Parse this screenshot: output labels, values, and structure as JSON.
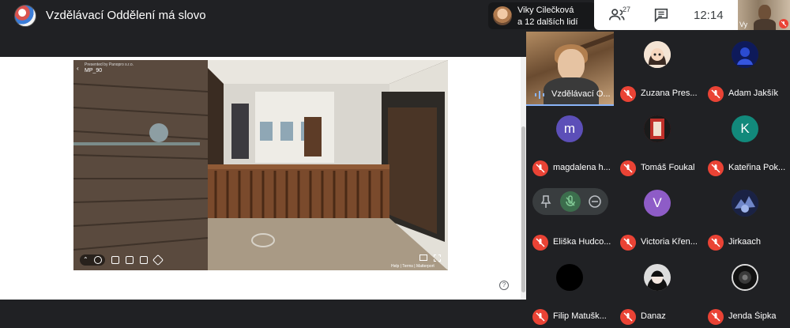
{
  "meeting": {
    "title": "Vzdělávací Oddělení má slovo",
    "clock": "12:14"
  },
  "speaker_chip": {
    "line1": "Viky Cilečková",
    "line2": "a 12 dalších lidí"
  },
  "controls": {
    "people_count": "27"
  },
  "self_view": {
    "label": "Vy"
  },
  "presentation": {
    "credit": "Presented by Panopro s.r.o.",
    "code": "MP_90",
    "footer": "Help | Terms | Matterport",
    "help": "?"
  },
  "participants": [
    {
      "name": "Vzdělávací O...",
      "initial": "",
      "color": ""
    },
    {
      "name": "Zuzana Pres...",
      "initial": "",
      "color": "#f4e4d4"
    },
    {
      "name": "Adam Jakšík",
      "initial": "",
      "color": "#1c2c7a"
    },
    {
      "name": "magdalena h...",
      "initial": "m",
      "color": "#5c4fb8"
    },
    {
      "name": "Tomáš Foukal",
      "initial": "",
      "color": "#a82a2a"
    },
    {
      "name": "Kateřina Pok...",
      "initial": "K",
      "color": "#12897b"
    },
    {
      "name": "Eliška Hudco...",
      "initial": "",
      "color": ""
    },
    {
      "name": "Victoria Křen...",
      "initial": "V",
      "color": "#8e5cc7"
    },
    {
      "name": "Jirkaach",
      "initial": "",
      "color": "#2b3b6e"
    },
    {
      "name": "Filip Matušk...",
      "initial": "",
      "color": "#000000"
    },
    {
      "name": "Danaz",
      "initial": "",
      "color": "#1d1d1d"
    },
    {
      "name": "Jenda Šipka",
      "initial": "",
      "color": "#222222"
    }
  ],
  "colors": {
    "mic_off": "#ea4335",
    "accent": "#8ab4f8",
    "bg": "#202124"
  }
}
